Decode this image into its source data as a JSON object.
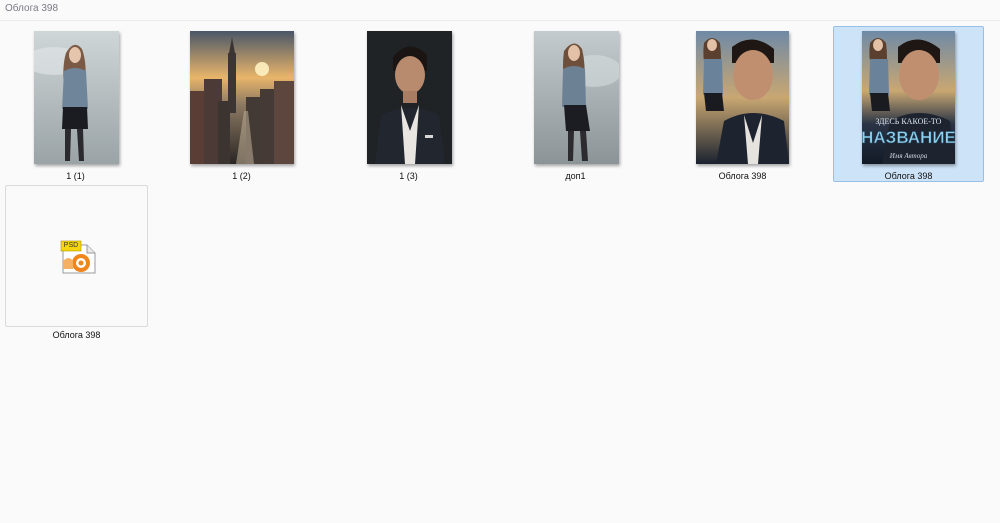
{
  "window": {
    "title": "Облога 398"
  },
  "files": [
    {
      "name": "1 (1)",
      "type": "image",
      "art": "woman-portrait",
      "selected": false
    },
    {
      "name": "1 (2)",
      "type": "image",
      "art": "city-sunset",
      "selected": false
    },
    {
      "name": "1 (3)",
      "type": "image",
      "art": "man-portrait",
      "selected": false
    },
    {
      "name": "доп1",
      "type": "image",
      "art": "woman-portrait-2",
      "selected": false
    },
    {
      "name": "Облога  398",
      "type": "image",
      "art": "cover-draft",
      "selected": false
    },
    {
      "name": "Облога 398",
      "type": "image",
      "art": "book-cover",
      "selected": true,
      "cover_text": {
        "line1": "ЗДЕСЬ КАКОЕ-ТО",
        "line2": "НАЗВАНИЕ",
        "author": "Имя Автора"
      }
    },
    {
      "name": "Облога 398",
      "type": "psd",
      "art": "psd-file-icon",
      "icon_label": "PSD",
      "selected": false
    }
  ],
  "colors": {
    "background": "#fafafb",
    "selection_fill": "#cde3f7",
    "selection_border": "#98c0e6",
    "psd_badge": "#f5d50f",
    "psd_ring": "#f0851c"
  }
}
